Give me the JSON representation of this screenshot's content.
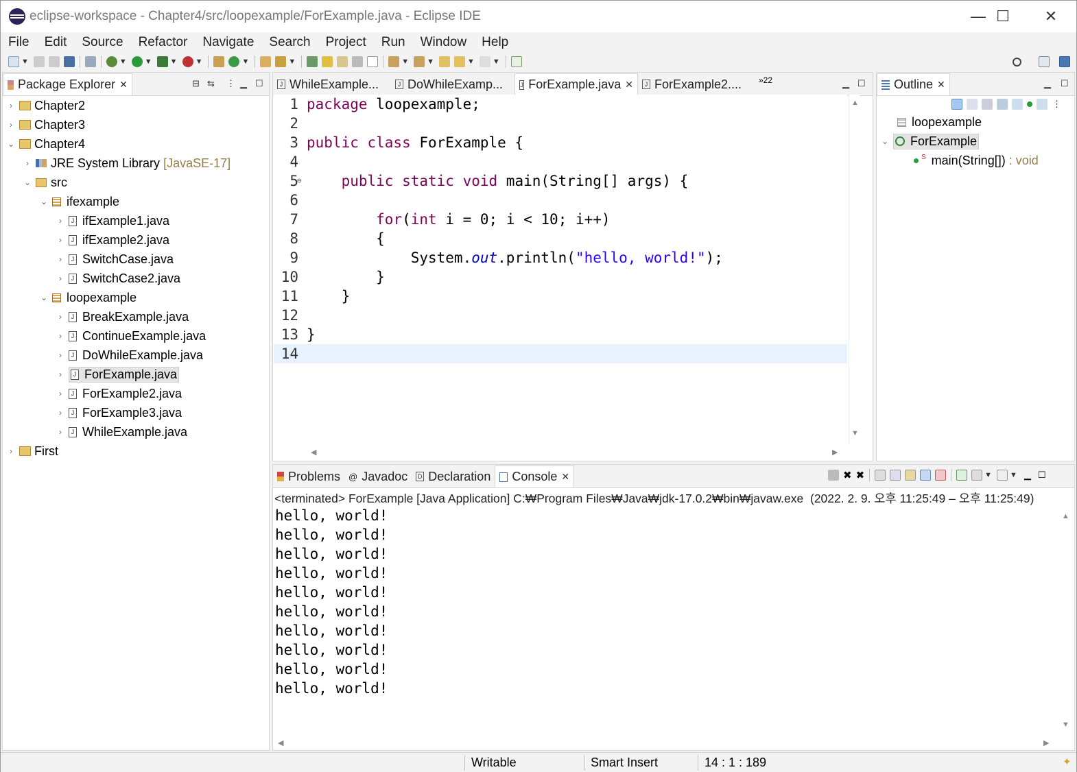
{
  "window": {
    "title": "eclipse-workspace - Chapter4/src/loopexample/ForExample.java - Eclipse IDE",
    "controls": {
      "minimize": "—",
      "maximize": "☐",
      "close": "✕"
    }
  },
  "menu": [
    "File",
    "Edit",
    "Source",
    "Refactor",
    "Navigate",
    "Search",
    "Project",
    "Run",
    "Window",
    "Help"
  ],
  "package_explorer": {
    "title": "Package Explorer",
    "items": [
      {
        "label": "Chapter2",
        "type": "project",
        "expanded": false
      },
      {
        "label": "Chapter3",
        "type": "project",
        "expanded": false
      },
      {
        "label": "Chapter4",
        "type": "project",
        "expanded": true
      },
      {
        "label": "JRE System Library",
        "decoration": "[JavaSE-17]",
        "type": "library"
      },
      {
        "label": "src",
        "type": "src"
      },
      {
        "label": "ifexample",
        "type": "package"
      },
      {
        "label": "ifExample1.java",
        "type": "file"
      },
      {
        "label": "ifExample2.java",
        "type": "file"
      },
      {
        "label": "SwitchCase.java",
        "type": "file"
      },
      {
        "label": "SwitchCase2.java",
        "type": "file"
      },
      {
        "label": "loopexample",
        "type": "package"
      },
      {
        "label": "BreakExample.java",
        "type": "file"
      },
      {
        "label": "ContinueExample.java",
        "type": "file"
      },
      {
        "label": "DoWhileExample.java",
        "type": "file"
      },
      {
        "label": "ForExample.java",
        "type": "file",
        "selected": true
      },
      {
        "label": "ForExample2.java",
        "type": "file"
      },
      {
        "label": "ForExample3.java",
        "type": "file"
      },
      {
        "label": "WhileExample.java",
        "type": "file"
      },
      {
        "label": "First",
        "type": "project",
        "expanded": false
      }
    ]
  },
  "editor": {
    "tabs": [
      "WhileExample...",
      "DoWhileExamp...",
      "ForExample.java",
      "ForExample2...."
    ],
    "active_tab": "ForExample.java",
    "overflow": "»22",
    "lines": [
      {
        "n": "1",
        "html": "<span class='kw'>package</span> loopexample;"
      },
      {
        "n": "2",
        "html": ""
      },
      {
        "n": "3",
        "html": "<span class='kw'>public class</span> ForExample {"
      },
      {
        "n": "4",
        "html": ""
      },
      {
        "n": "5",
        "html": "    <span class='kw'>public static void</span> main(String[] args) {"
      },
      {
        "n": "6",
        "html": ""
      },
      {
        "n": "7",
        "html": "        <span class='kw'>for</span>(<span class='kw'>int</span> i = 0; i &lt; 10; i++)"
      },
      {
        "n": "8",
        "html": "        {"
      },
      {
        "n": "9",
        "html": "            System.<span class='fld'>out</span>.println(<span class='str'>\"hello, world!\"</span>);"
      },
      {
        "n": "10",
        "html": "        }"
      },
      {
        "n": "11",
        "html": "    }"
      },
      {
        "n": "12",
        "html": ""
      },
      {
        "n": "13",
        "html": "}"
      },
      {
        "n": "14",
        "html": ""
      }
    ],
    "current_line": 14
  },
  "outline": {
    "title": "Outline",
    "package": "loopexample",
    "class": "ForExample",
    "method": "main(String[])",
    "method_type": ": void"
  },
  "bottom": {
    "tabs": [
      "Problems",
      "Javadoc",
      "Declaration",
      "Console"
    ],
    "active_tab": "Console",
    "header": "<terminated> ForExample [Java Application] C:₩Program Files₩Java₩jdk-17.0.2₩bin₩javaw.exe  (2022. 2. 9. 오후 11:25:49 – 오후 11:25:49)",
    "output": [
      "hello, world!",
      "hello, world!",
      "hello, world!",
      "hello, world!",
      "hello, world!",
      "hello, world!",
      "hello, world!",
      "hello, world!",
      "hello, world!",
      "hello, world!"
    ]
  },
  "status": {
    "writable": "Writable",
    "insert_mode": "Smart Insert",
    "position": "14 : 1 : 189"
  },
  "colors": {
    "keyword": "#7f0055",
    "string": "#2a00ff",
    "field": "#0000c0",
    "current_line": "#e8f2fe"
  }
}
